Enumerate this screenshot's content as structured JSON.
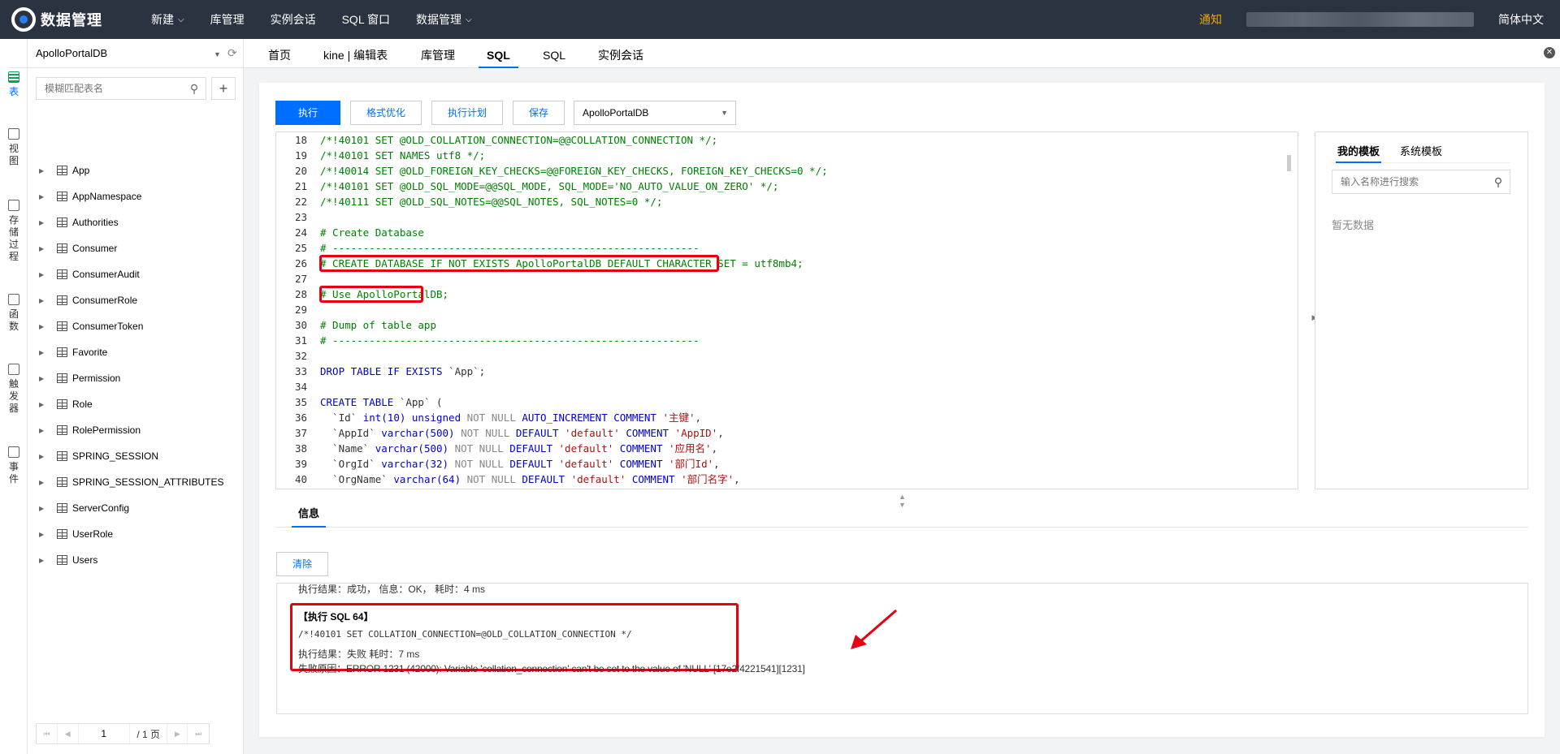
{
  "nav": {
    "brand": "数据管理",
    "items": [
      {
        "label": "新建",
        "dropdown": true
      },
      {
        "label": "库管理",
        "dropdown": false
      },
      {
        "label": "实例会话",
        "dropdown": false
      },
      {
        "label": "SQL 窗口",
        "dropdown": false
      },
      {
        "label": "数据管理",
        "dropdown": true
      }
    ],
    "notice": "通知",
    "language": "简体中文"
  },
  "rail": {
    "items": [
      {
        "label": "表",
        "active": true
      },
      {
        "label": "视图",
        "active": false
      },
      {
        "label": "存储过程",
        "active": false
      },
      {
        "label": "函数",
        "active": false
      },
      {
        "label": "触发器",
        "active": false
      },
      {
        "label": "事件",
        "active": false
      }
    ]
  },
  "tree": {
    "database": "ApolloPortalDB",
    "search_placeholder": "模糊匹配表名",
    "tables": [
      "App",
      "AppNamespace",
      "Authorities",
      "Consumer",
      "ConsumerAudit",
      "ConsumerRole",
      "ConsumerToken",
      "Favorite",
      "Permission",
      "Role",
      "RolePermission",
      "SPRING_SESSION",
      "SPRING_SESSION_ATTRIBUTES",
      "ServerConfig",
      "UserRole",
      "Users"
    ],
    "pager": {
      "current": "1",
      "total": "/ 1 页"
    }
  },
  "tabs": {
    "items": [
      {
        "label": "首页",
        "active": false
      },
      {
        "label": "kine | 编辑表",
        "active": false
      },
      {
        "label": "库管理",
        "active": false
      },
      {
        "label": "SQL",
        "active": true
      },
      {
        "label": "SQL",
        "active": false
      },
      {
        "label": "实例会话",
        "active": false
      }
    ]
  },
  "toolbar": {
    "execute": "执行",
    "format": "格式优化",
    "plan": "执行计划",
    "save": "保存",
    "db_select": "ApolloPortalDB"
  },
  "editor": {
    "lines": [
      {
        "n": "18",
        "text": "/*!40101 SET @OLD_COLLATION_CONNECTION=@@COLLATION_CONNECTION */;"
      },
      {
        "n": "19",
        "text": "/*!40101 SET NAMES utf8 */;"
      },
      {
        "n": "20",
        "text": "/*!40014 SET @OLD_FOREIGN_KEY_CHECKS=@@FOREIGN_KEY_CHECKS, FOREIGN_KEY_CHECKS=0 */;"
      },
      {
        "n": "21",
        "text": "/*!40101 SET @OLD_SQL_MODE=@@SQL_MODE, SQL_MODE='NO_AUTO_VALUE_ON_ZERO' */;"
      },
      {
        "n": "22",
        "text": "/*!40111 SET @OLD_SQL_NOTES=@@SQL_NOTES, SQL_NOTES=0 */;"
      },
      {
        "n": "23",
        "text": ""
      },
      {
        "n": "24",
        "text": "# Create Database"
      },
      {
        "n": "25",
        "text": "# ------------------------------------------------------------"
      },
      {
        "n": "26",
        "text": "# CREATE DATABASE IF NOT EXISTS ApolloPortalDB DEFAULT CHARACTER SET = utf8mb4;"
      },
      {
        "n": "27",
        "text": ""
      },
      {
        "n": "28",
        "text": "# Use ApolloPortalDB;"
      },
      {
        "n": "29",
        "text": ""
      },
      {
        "n": "30",
        "text": "# Dump of table app"
      },
      {
        "n": "31",
        "text": "# ------------------------------------------------------------"
      },
      {
        "n": "32",
        "text": ""
      }
    ],
    "line33": {
      "n": "33",
      "kw1": "DROP TABLE IF EXISTS",
      "rest": " `App`;"
    },
    "line34": {
      "n": "34"
    },
    "line35": {
      "n": "35",
      "kw1": "CREATE TABLE",
      "rest": " `App` ("
    },
    "line36": {
      "n": "36",
      "a": "  `Id` ",
      "b": "int(10) unsigned",
      "c": " NOT NULL",
      "d": " AUTO_INCREMENT COMMENT",
      "e": " '主键'",
      "f": ","
    },
    "line37": {
      "n": "37",
      "a": "  `AppId` ",
      "b": "varchar(500)",
      "c": " NOT NULL",
      "d": " DEFAULT",
      "e": " 'default'",
      "d2": " COMMENT",
      "e2": " 'AppID'",
      "f": ","
    },
    "line38": {
      "n": "38",
      "a": "  `Name` ",
      "b": "varchar(500)",
      "c": " NOT NULL",
      "d": " DEFAULT",
      "e": " 'default'",
      "d2": " COMMENT",
      "e2": " '应用名'",
      "f": ","
    },
    "line39": {
      "n": "39",
      "a": "  `OrgId` ",
      "b": "varchar(32)",
      "c": " NOT NULL",
      "d": " DEFAULT",
      "e": " 'default'",
      "d2": " COMMENT",
      "e2": " '部门Id'",
      "f": ","
    },
    "line40": {
      "n": "40",
      "a": "  `OrgName` ",
      "b": "varchar(64)",
      "c": " NOT NULL",
      "d": " DEFAULT",
      "e": " 'default'",
      "d2": " COMMENT",
      "e2": " '部门名字'",
      "f": ","
    }
  },
  "templates": {
    "tab_mine": "我的模板",
    "tab_system": "系统模板",
    "search_placeholder": "输入名称进行搜索",
    "empty": "暂无数据"
  },
  "info": {
    "tab": "信息",
    "clear": "清除",
    "prev_result": "执行结果：成功，    信息：OK，    耗时：4 ms",
    "title": "【执行 SQL 64】",
    "sql": "/*!40101 SET COLLATION_CONNECTION=@OLD_COLLATION_CONNECTION */",
    "result": "执行结果：失败      耗时：7 ms",
    "reason": "失败原因：ERROR 1231 (42000): Variable 'collation_connection' can't be set to the value of 'NULL' [17e2f4221541][1231]"
  },
  "colors": {
    "accent": "#006eff",
    "nav_bg": "#2b3240",
    "highlight": "#e60012",
    "code_comment": "#008000",
    "keyword": "#0000cc"
  }
}
